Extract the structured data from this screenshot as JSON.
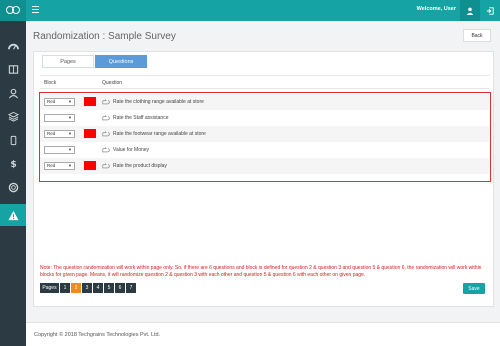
{
  "header": {
    "welcome": "Welcome, User"
  },
  "sidebar": {
    "items": [
      {
        "icon": "dashboard-icon"
      },
      {
        "icon": "book-icon"
      },
      {
        "icon": "user-icon"
      },
      {
        "icon": "layers-icon"
      },
      {
        "icon": "mobile-icon"
      },
      {
        "icon": "dollar-icon"
      },
      {
        "icon": "lifebuoy-icon"
      },
      {
        "icon": "warning-icon",
        "active": true
      }
    ]
  },
  "page": {
    "title": "Randomization : Sample Survey",
    "back_label": "Back"
  },
  "tabs": [
    {
      "label": "Pages",
      "active": false
    },
    {
      "label": "Questions",
      "active": true
    }
  ],
  "table": {
    "col_block": "Block",
    "col_question": "Question",
    "rows": [
      {
        "block": "Red",
        "swatch": "#ff0000",
        "question": "Rate the clothing range available at store"
      },
      {
        "block": "",
        "swatch": null,
        "question": "Rate the Staff assistance"
      },
      {
        "block": "Red",
        "swatch": "#ff0000",
        "question": "Rate the footwear range available at store"
      },
      {
        "block": "",
        "swatch": null,
        "question": "Value for Money"
      },
      {
        "block": "Red",
        "swatch": "#ff0000",
        "question": "Rate the product display"
      }
    ]
  },
  "note": "Note: The question randomization will work within page only. So, if there are 6 questions and block is defined for question 2 & question 3 and question 5 & question 6, the randomization will work within blocks for given page. Means, it will randomize question 2 & question 3 with each other and question 5 & question 6 with each other on given page.",
  "pagination": {
    "label": "Pages",
    "pages": [
      "1",
      "2",
      "3",
      "4",
      "5",
      "6",
      "7"
    ],
    "current": "2"
  },
  "save_label": "Save",
  "footer": "Copyright © 2018 Techgrains Technologies Pvt. Ltd.",
  "colors": {
    "accent": "#16a3a3",
    "sidebar": "#2c3a44",
    "highlight_border": "#e03030",
    "active_page": "#f08a1c",
    "tab_active": "#5b9bd9"
  }
}
